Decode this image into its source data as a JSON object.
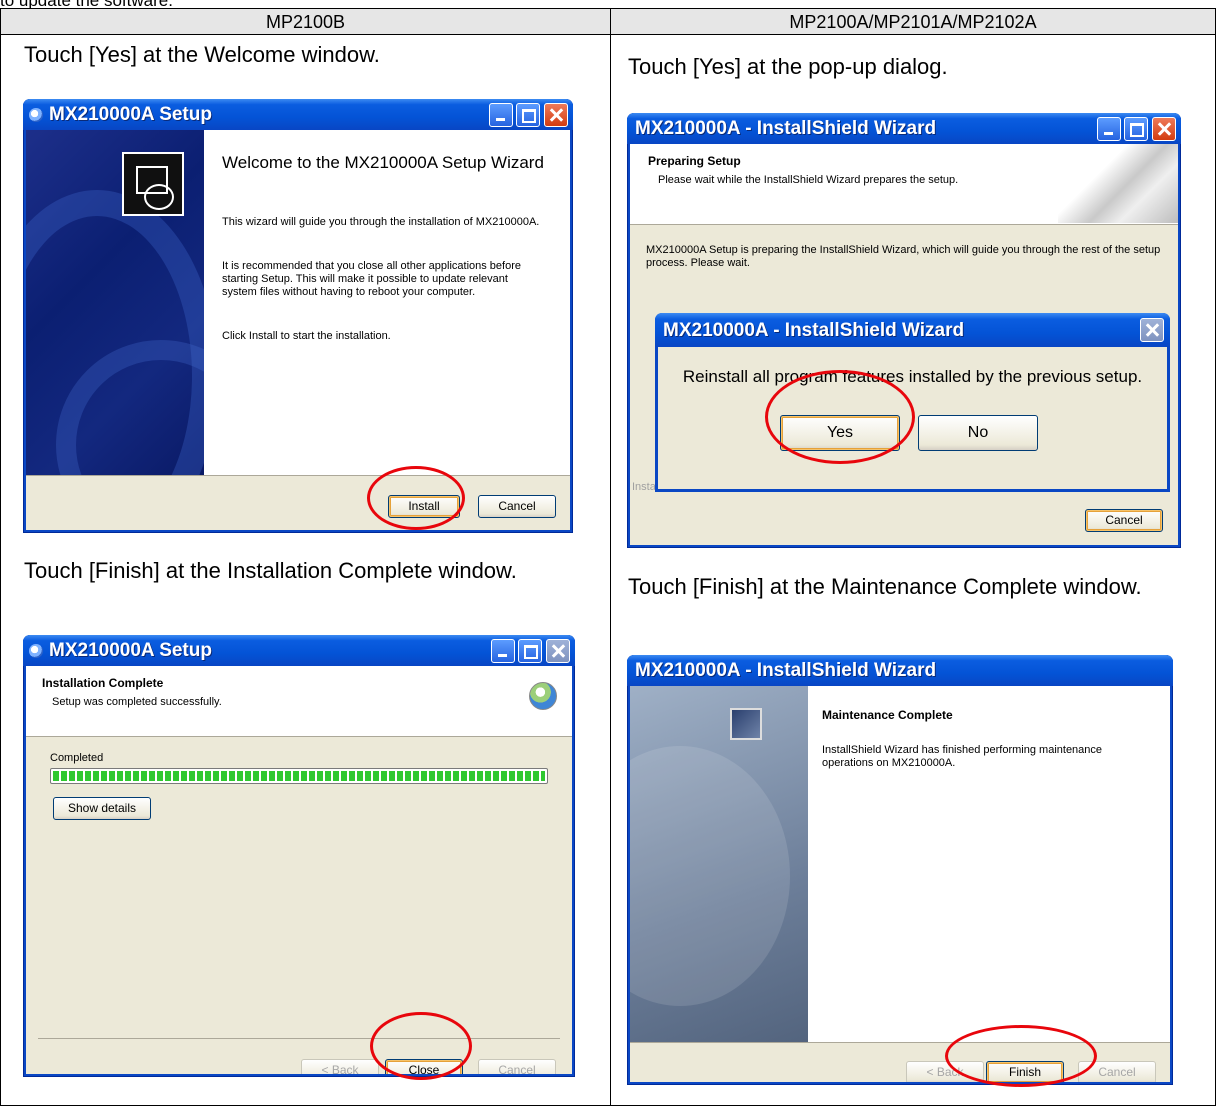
{
  "intro_text": "to update the software.",
  "columns": {
    "left_header": "MP2100B",
    "right_header": "MP2100A/MP2101A/MP2102A"
  },
  "captions": {
    "welcome": "Touch [Yes] at the Welcome window.",
    "popup": "Touch [Yes] at the pop-up dialog.",
    "install_complete": "Touch [Finish] at the Installation Complete window.",
    "maintenance_complete": "Touch [Finish] at the Maintenance Complete window."
  },
  "win_welcome": {
    "title": "MX210000A Setup",
    "heading": "Welcome to the MX210000A Setup Wizard",
    "para1": "This wizard will guide you through the installation of MX210000A.",
    "para2": "It is recommended that you close all other applications before starting Setup. This will make it possible to update relevant system files without having to reboot your computer.",
    "para3": "Click Install to start the installation.",
    "install_label": "Install",
    "cancel_label": "Cancel"
  },
  "win_preparing": {
    "title": "MX210000A - InstallShield Wizard",
    "heading": "Preparing Setup",
    "subheading": "Please wait while the InstallShield Wizard prepares the setup.",
    "body": "MX210000A Setup is preparing the InstallShield Wizard, which will guide you through the rest of the setup process. Please wait.",
    "brand": "InstallShield",
    "cancel_label": "Cancel",
    "popup": {
      "title": "MX210000A - InstallShield Wizard",
      "message": "Reinstall all program features installed by the previous setup.",
      "yes_label": "Yes",
      "no_label": "No"
    }
  },
  "win_install_complete": {
    "title": "MX210000A Setup",
    "heading": "Installation Complete",
    "subheading": "Setup was completed successfully.",
    "progress_label": "Completed",
    "progress_fraction": 1.0,
    "show_details_label": "Show details",
    "back_label": "< Back",
    "close_label": "Close",
    "cancel_label": "Cancel"
  },
  "win_maintenance": {
    "title": "MX210000A - InstallShield Wizard",
    "heading": "Maintenance Complete",
    "body": "InstallShield Wizard has finished performing maintenance operations on MX210000A.",
    "back_label": "< Back",
    "finish_label": "Finish",
    "cancel_label": "Cancel"
  }
}
